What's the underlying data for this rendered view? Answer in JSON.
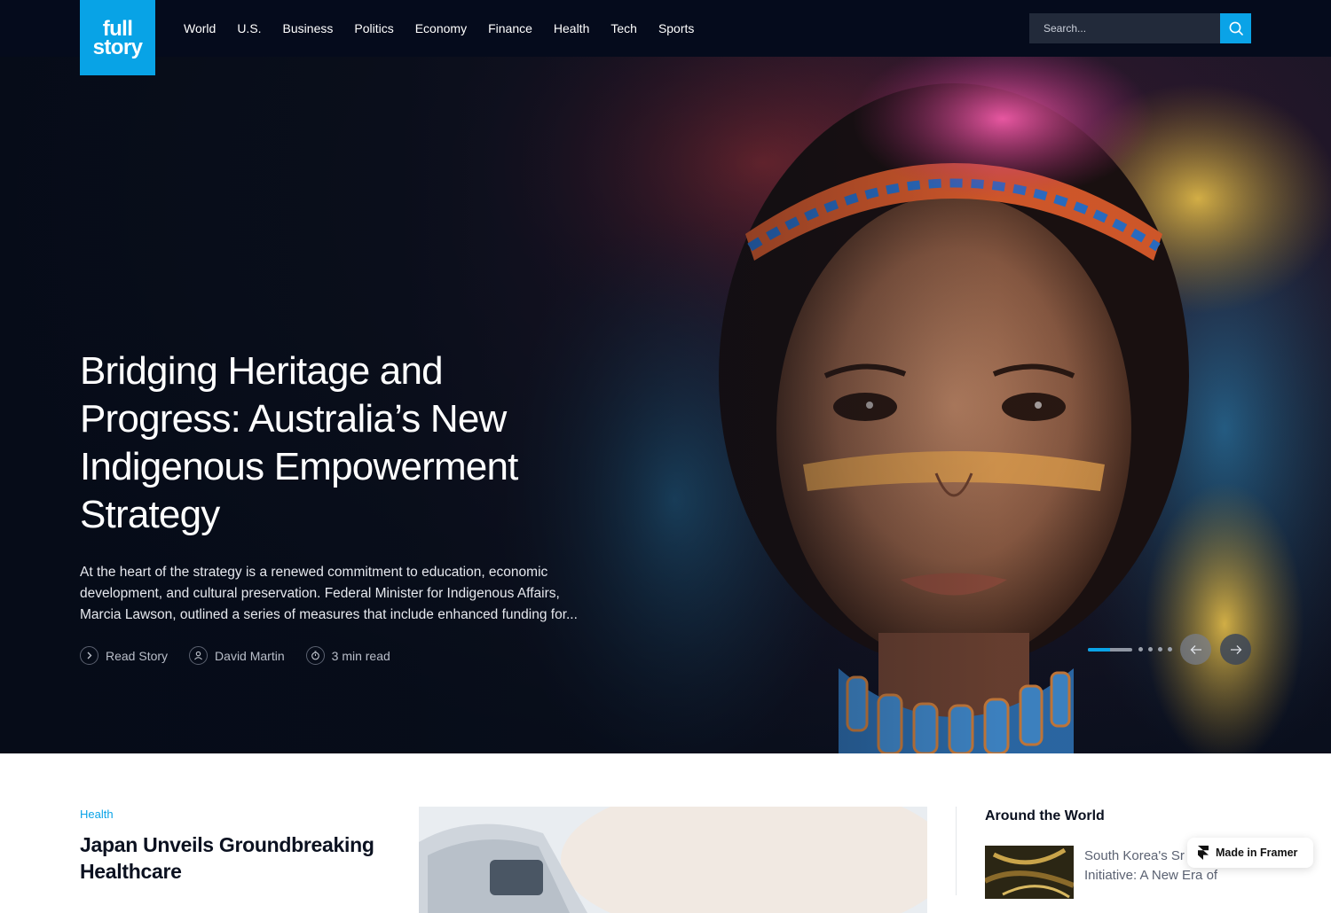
{
  "logo": {
    "line1": "full",
    "line2": "story"
  },
  "nav": {
    "items": [
      "World",
      "U.S.",
      "Business",
      "Politics",
      "Economy",
      "Finance",
      "Health",
      "Tech",
      "Sports"
    ]
  },
  "search": {
    "placeholder": "Search...",
    "icon": "search-icon"
  },
  "hero": {
    "title": "Bridging Heritage and Progress: Australia’s New Indigenous Empowerment Strategy",
    "excerpt": "At the heart of the strategy is a renewed commitment to education, economic development, and cultural preservation. Federal Minister for Indigenous Affairs, Marcia Lawson, outlined a series of measures that include enhanced funding for...",
    "meta": {
      "read_label": "Read Story",
      "author": "David Martin",
      "read_time": "3 min read"
    },
    "slider": {
      "progress": 0.5,
      "total_slides": 5
    }
  },
  "featured": {
    "category": "Health",
    "title": "Japan Unveils Groundbreaking Healthcare"
  },
  "sidebar": {
    "heading": "Around the World",
    "item_text": "South Korea's Sr Initiative: A New Era of"
  },
  "badge": {
    "label": "Made in Framer"
  },
  "colors": {
    "accent": "#0aa3e7",
    "nav_bg": "#050b1c",
    "dark_text": "#0b1120"
  }
}
